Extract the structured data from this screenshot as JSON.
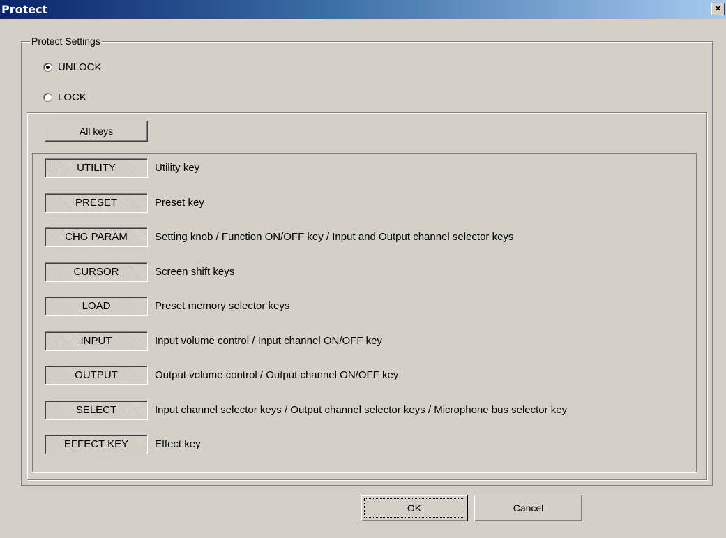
{
  "window": {
    "title": "Protect",
    "close_symbol": "×"
  },
  "protect_settings": {
    "label": "Protect Settings",
    "options": [
      {
        "label": "UNLOCK",
        "selected": true
      },
      {
        "label": "LOCK",
        "selected": false
      }
    ]
  },
  "all_keys_label": "All keys",
  "keys": [
    {
      "button": "UTILITY",
      "description": "Utility key"
    },
    {
      "button": "PRESET",
      "description": "Preset key"
    },
    {
      "button": "CHG PARAM",
      "description": "Setting knob / Function ON/OFF key /  Input and Output channel selector keys"
    },
    {
      "button": "CURSOR",
      "description": "Screen shift keys"
    },
    {
      "button": "LOAD",
      "description": "Preset memory selector keys"
    },
    {
      "button": "INPUT",
      "description": "Input volume control / Input channel ON/OFF key"
    },
    {
      "button": "OUTPUT",
      "description": "Output volume control / Output channel ON/OFF key"
    },
    {
      "button": "SELECT",
      "description": "Input channel selector keys / Output channel selector keys / Microphone bus selector key"
    },
    {
      "button": "EFFECT KEY",
      "description": "Effect key"
    }
  ],
  "footer": {
    "ok_label": "OK",
    "cancel_label": "Cancel"
  }
}
